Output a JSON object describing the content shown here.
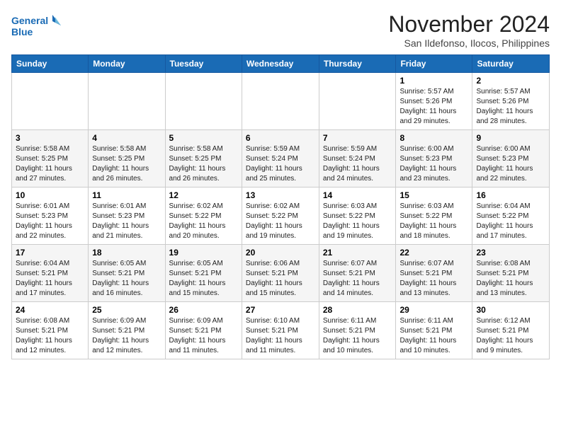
{
  "header": {
    "logo_line1": "General",
    "logo_line2": "Blue",
    "month_year": "November 2024",
    "location": "San Ildefonso, Ilocos, Philippines"
  },
  "days_of_week": [
    "Sunday",
    "Monday",
    "Tuesday",
    "Wednesday",
    "Thursday",
    "Friday",
    "Saturday"
  ],
  "weeks": [
    [
      {
        "day": "",
        "info": ""
      },
      {
        "day": "",
        "info": ""
      },
      {
        "day": "",
        "info": ""
      },
      {
        "day": "",
        "info": ""
      },
      {
        "day": "",
        "info": ""
      },
      {
        "day": "1",
        "info": "Sunrise: 5:57 AM\nSunset: 5:26 PM\nDaylight: 11 hours and 29 minutes."
      },
      {
        "day": "2",
        "info": "Sunrise: 5:57 AM\nSunset: 5:26 PM\nDaylight: 11 hours and 28 minutes."
      }
    ],
    [
      {
        "day": "3",
        "info": "Sunrise: 5:58 AM\nSunset: 5:25 PM\nDaylight: 11 hours and 27 minutes."
      },
      {
        "day": "4",
        "info": "Sunrise: 5:58 AM\nSunset: 5:25 PM\nDaylight: 11 hours and 26 minutes."
      },
      {
        "day": "5",
        "info": "Sunrise: 5:58 AM\nSunset: 5:25 PM\nDaylight: 11 hours and 26 minutes."
      },
      {
        "day": "6",
        "info": "Sunrise: 5:59 AM\nSunset: 5:24 PM\nDaylight: 11 hours and 25 minutes."
      },
      {
        "day": "7",
        "info": "Sunrise: 5:59 AM\nSunset: 5:24 PM\nDaylight: 11 hours and 24 minutes."
      },
      {
        "day": "8",
        "info": "Sunrise: 6:00 AM\nSunset: 5:23 PM\nDaylight: 11 hours and 23 minutes."
      },
      {
        "day": "9",
        "info": "Sunrise: 6:00 AM\nSunset: 5:23 PM\nDaylight: 11 hours and 22 minutes."
      }
    ],
    [
      {
        "day": "10",
        "info": "Sunrise: 6:01 AM\nSunset: 5:23 PM\nDaylight: 11 hours and 22 minutes."
      },
      {
        "day": "11",
        "info": "Sunrise: 6:01 AM\nSunset: 5:23 PM\nDaylight: 11 hours and 21 minutes."
      },
      {
        "day": "12",
        "info": "Sunrise: 6:02 AM\nSunset: 5:22 PM\nDaylight: 11 hours and 20 minutes."
      },
      {
        "day": "13",
        "info": "Sunrise: 6:02 AM\nSunset: 5:22 PM\nDaylight: 11 hours and 19 minutes."
      },
      {
        "day": "14",
        "info": "Sunrise: 6:03 AM\nSunset: 5:22 PM\nDaylight: 11 hours and 19 minutes."
      },
      {
        "day": "15",
        "info": "Sunrise: 6:03 AM\nSunset: 5:22 PM\nDaylight: 11 hours and 18 minutes."
      },
      {
        "day": "16",
        "info": "Sunrise: 6:04 AM\nSunset: 5:22 PM\nDaylight: 11 hours and 17 minutes."
      }
    ],
    [
      {
        "day": "17",
        "info": "Sunrise: 6:04 AM\nSunset: 5:21 PM\nDaylight: 11 hours and 17 minutes."
      },
      {
        "day": "18",
        "info": "Sunrise: 6:05 AM\nSunset: 5:21 PM\nDaylight: 11 hours and 16 minutes."
      },
      {
        "day": "19",
        "info": "Sunrise: 6:05 AM\nSunset: 5:21 PM\nDaylight: 11 hours and 15 minutes."
      },
      {
        "day": "20",
        "info": "Sunrise: 6:06 AM\nSunset: 5:21 PM\nDaylight: 11 hours and 15 minutes."
      },
      {
        "day": "21",
        "info": "Sunrise: 6:07 AM\nSunset: 5:21 PM\nDaylight: 11 hours and 14 minutes."
      },
      {
        "day": "22",
        "info": "Sunrise: 6:07 AM\nSunset: 5:21 PM\nDaylight: 11 hours and 13 minutes."
      },
      {
        "day": "23",
        "info": "Sunrise: 6:08 AM\nSunset: 5:21 PM\nDaylight: 11 hours and 13 minutes."
      }
    ],
    [
      {
        "day": "24",
        "info": "Sunrise: 6:08 AM\nSunset: 5:21 PM\nDaylight: 11 hours and 12 minutes."
      },
      {
        "day": "25",
        "info": "Sunrise: 6:09 AM\nSunset: 5:21 PM\nDaylight: 11 hours and 12 minutes."
      },
      {
        "day": "26",
        "info": "Sunrise: 6:09 AM\nSunset: 5:21 PM\nDaylight: 11 hours and 11 minutes."
      },
      {
        "day": "27",
        "info": "Sunrise: 6:10 AM\nSunset: 5:21 PM\nDaylight: 11 hours and 11 minutes."
      },
      {
        "day": "28",
        "info": "Sunrise: 6:11 AM\nSunset: 5:21 PM\nDaylight: 11 hours and 10 minutes."
      },
      {
        "day": "29",
        "info": "Sunrise: 6:11 AM\nSunset: 5:21 PM\nDaylight: 11 hours and 10 minutes."
      },
      {
        "day": "30",
        "info": "Sunrise: 6:12 AM\nSunset: 5:21 PM\nDaylight: 11 hours and 9 minutes."
      }
    ]
  ]
}
